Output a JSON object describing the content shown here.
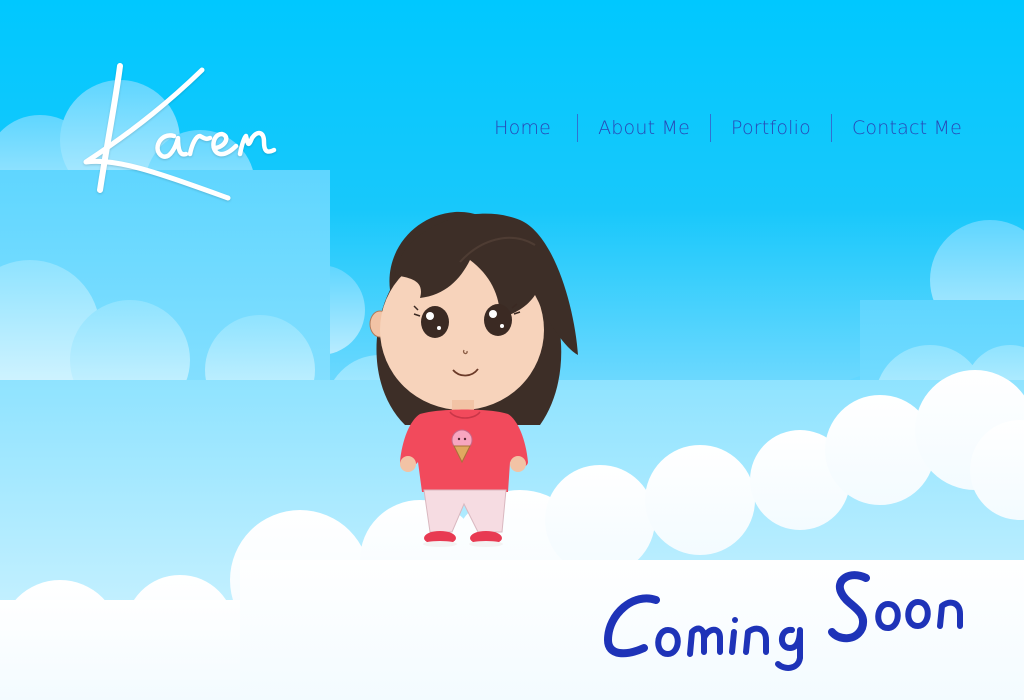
{
  "brand": {
    "logo_text": "Karen"
  },
  "nav": {
    "items": [
      {
        "label": "Home"
      },
      {
        "label": "About Me"
      },
      {
        "label": "Portfolio"
      },
      {
        "label": "Contact Me"
      }
    ]
  },
  "hero": {
    "headline": "Coming Soon",
    "illustration": "girl-character-icon"
  },
  "colors": {
    "sky": "#00c8ff",
    "nav_text": "#2a47b5",
    "headline": "#1e33b8",
    "shirt": "#f24a5c",
    "hair": "#3d2e27",
    "cloud": "#ffffff"
  }
}
